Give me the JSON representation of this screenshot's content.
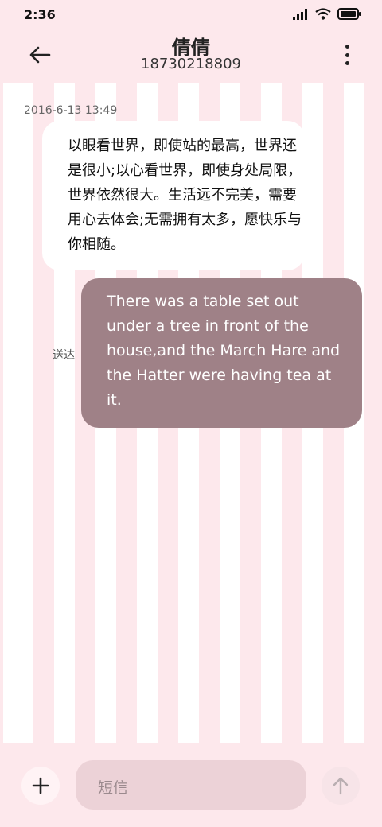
{
  "status_bar": {
    "time": "2:36"
  },
  "header": {
    "title": "倩倩",
    "subtitle": "18730218809"
  },
  "messages": [
    {
      "timestamp": "2016-6-13 13:49",
      "text": "以眼看世界，即使站的最高，世界还是很小;以心看世界，即使身处局限，世界依然很大。生活远不完美，需要用心去体会;无需拥有太多，愿快乐与你相随。"
    },
    {
      "text": "There was a table set out under a tree in front of the house,and the March Hare and the Hatter were having tea at it.",
      "status": "送达"
    }
  ],
  "composer": {
    "placeholder": "短信"
  },
  "colors": {
    "background": "#fde8ec",
    "outgoing_bubble": "#9f8187",
    "incoming_bubble": "#ffffff"
  }
}
